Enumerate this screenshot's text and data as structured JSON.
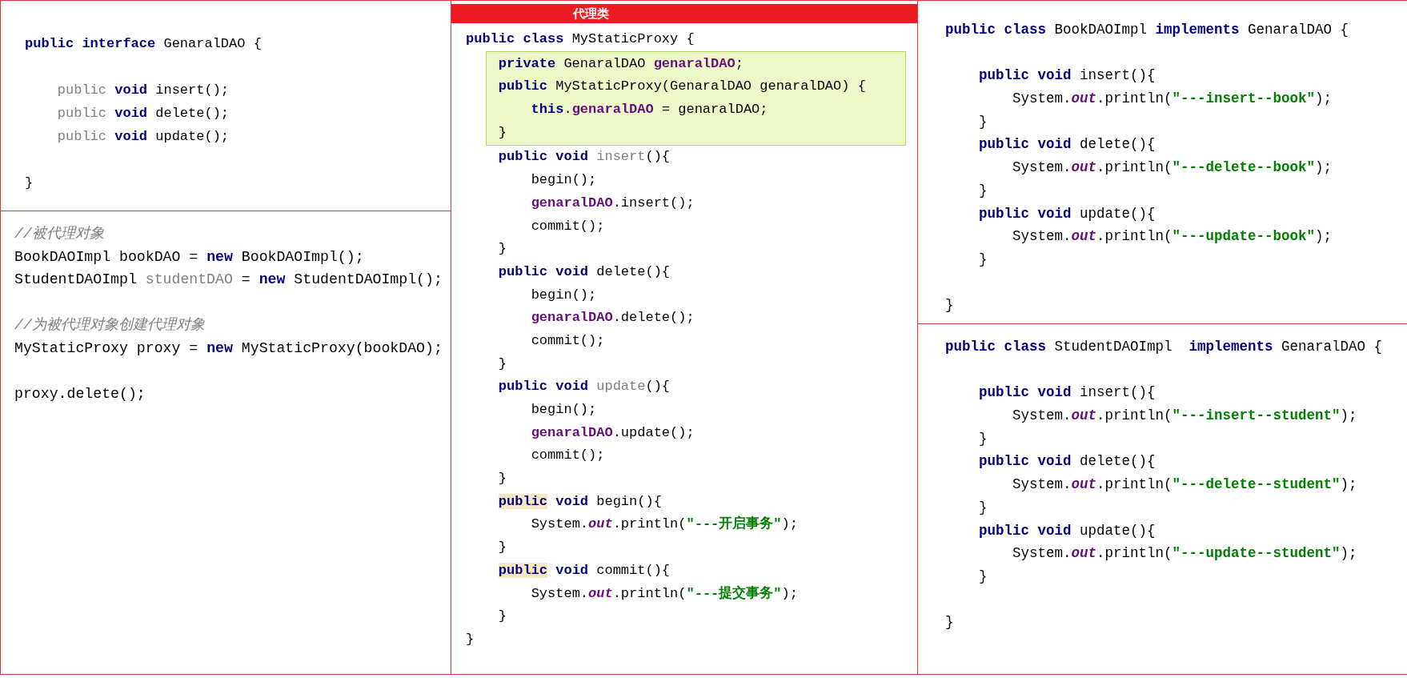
{
  "columns": [
    {
      "panels": [
        {
          "blocks": [
            {
              "boxed": false,
              "lines": [
                {
                  "kind": "code",
                  "segments": [
                    {
                      "kind": "keyword",
                      "text": "public interface "
                    },
                    {
                      "kind": "plain",
                      "text": "GenaralDAO {"
                    }
                  ]
                },
                {
                  "kind": "blank"
                },
                {
                  "kind": "code",
                  "segments": [
                    {
                      "kind": "unused",
                      "text": "    public "
                    },
                    {
                      "kind": "keyword",
                      "text": "void "
                    },
                    {
                      "kind": "plain",
                      "text": "insert();"
                    }
                  ]
                },
                {
                  "kind": "code",
                  "segments": [
                    {
                      "kind": "unused",
                      "text": "    public "
                    },
                    {
                      "kind": "keyword",
                      "text": "void "
                    },
                    {
                      "kind": "plain",
                      "text": "delete();"
                    }
                  ]
                },
                {
                  "kind": "code",
                  "segments": [
                    {
                      "kind": "unused",
                      "text": "    public "
                    },
                    {
                      "kind": "keyword",
                      "text": "void "
                    },
                    {
                      "kind": "plain",
                      "text": "update();"
                    }
                  ]
                },
                {
                  "kind": "blank"
                },
                {
                  "kind": "code",
                  "segments": [
                    {
                      "kind": "plain",
                      "text": "}"
                    }
                  ]
                }
              ]
            }
          ]
        },
        {
          "blocks": [
            {
              "boxed": false,
              "lines": [
                {
                  "kind": "code",
                  "segments": [
                    {
                      "kind": "comment",
                      "text": "//被代理对象"
                    }
                  ]
                },
                {
                  "kind": "code",
                  "segments": [
                    {
                      "kind": "plain",
                      "text": "BookDAOImpl bookDAO = "
                    },
                    {
                      "kind": "keyword",
                      "text": "new "
                    },
                    {
                      "kind": "plain",
                      "text": "BookDAOImpl();"
                    }
                  ]
                },
                {
                  "kind": "code",
                  "segments": [
                    {
                      "kind": "plain",
                      "text": "StudentDAOImpl "
                    },
                    {
                      "kind": "unused",
                      "text": "studentDAO"
                    },
                    {
                      "kind": "plain",
                      "text": " = "
                    },
                    {
                      "kind": "keyword",
                      "text": "new "
                    },
                    {
                      "kind": "plain",
                      "text": "StudentDAOImpl();"
                    }
                  ]
                },
                {
                  "kind": "blank"
                },
                {
                  "kind": "code",
                  "segments": [
                    {
                      "kind": "comment",
                      "text": "//为被代理对象创建代理对象"
                    }
                  ]
                },
                {
                  "kind": "code",
                  "segments": [
                    {
                      "kind": "plain",
                      "text": "MyStaticProxy proxy = "
                    },
                    {
                      "kind": "keyword",
                      "text": "new "
                    },
                    {
                      "kind": "plain",
                      "text": "MyStaticProxy(bookDAO);"
                    }
                  ]
                },
                {
                  "kind": "blank"
                },
                {
                  "kind": "code",
                  "segments": [
                    {
                      "kind": "plain",
                      "text": "proxy.delete();"
                    }
                  ]
                }
              ]
            }
          ]
        }
      ]
    },
    {
      "panels": [
        {
          "title": "代理类",
          "blocks": [
            {
              "boxed": false,
              "lines": [
                {
                  "kind": "code",
                  "segments": [
                    {
                      "kind": "keyword",
                      "text": "public class "
                    },
                    {
                      "kind": "plain",
                      "text": "MyStaticProxy {"
                    }
                  ]
                }
              ]
            },
            {
              "boxed": true,
              "lines": [
                {
                  "kind": "code",
                  "segments": [
                    {
                      "kind": "keyword",
                      "text": "private "
                    },
                    {
                      "kind": "plain",
                      "text": "GenaralDAO "
                    },
                    {
                      "kind": "field",
                      "text": "genaralDAO"
                    },
                    {
                      "kind": "plain",
                      "text": ";"
                    }
                  ]
                },
                {
                  "kind": "code",
                  "segments": [
                    {
                      "kind": "keyword",
                      "text": "public "
                    },
                    {
                      "kind": "plain",
                      "text": "MyStaticProxy(GenaralDAO genaralDAO) {"
                    }
                  ]
                },
                {
                  "kind": "code",
                  "segments": [
                    {
                      "kind": "keyword",
                      "text": "    this"
                    },
                    {
                      "kind": "plain",
                      "text": "."
                    },
                    {
                      "kind": "field",
                      "text": "genaralDAO"
                    },
                    {
                      "kind": "plain",
                      "text": " = genaralDAO;"
                    }
                  ]
                },
                {
                  "kind": "code",
                  "segments": [
                    {
                      "kind": "plain",
                      "text": "}"
                    }
                  ]
                }
              ]
            },
            {
              "boxed": false,
              "lines": [
                {
                  "kind": "code",
                  "segments": [
                    {
                      "kind": "keyword",
                      "text": "    public void "
                    },
                    {
                      "kind": "unused",
                      "text": "insert"
                    },
                    {
                      "kind": "plain",
                      "text": "(){"
                    }
                  ]
                },
                {
                  "kind": "code",
                  "segments": [
                    {
                      "kind": "plain",
                      "text": "        begin();"
                    }
                  ]
                },
                {
                  "kind": "code",
                  "segments": [
                    {
                      "kind": "field",
                      "text": "        genaralDAO"
                    },
                    {
                      "kind": "plain",
                      "text": ".insert();"
                    }
                  ]
                },
                {
                  "kind": "code",
                  "segments": [
                    {
                      "kind": "plain",
                      "text": "        commit();"
                    }
                  ]
                },
                {
                  "kind": "code",
                  "segments": [
                    {
                      "kind": "plain",
                      "text": "    }"
                    }
                  ]
                },
                {
                  "kind": "code",
                  "segments": [
                    {
                      "kind": "keyword",
                      "text": "    public void "
                    },
                    {
                      "kind": "plain",
                      "text": "delete(){"
                    }
                  ]
                },
                {
                  "kind": "code",
                  "segments": [
                    {
                      "kind": "plain",
                      "text": "        begin();"
                    }
                  ]
                },
                {
                  "kind": "code",
                  "segments": [
                    {
                      "kind": "field",
                      "text": "        genaralDAO"
                    },
                    {
                      "kind": "plain",
                      "text": ".delete();"
                    }
                  ]
                },
                {
                  "kind": "code",
                  "segments": [
                    {
                      "kind": "plain",
                      "text": "        commit();"
                    }
                  ]
                },
                {
                  "kind": "code",
                  "segments": [
                    {
                      "kind": "plain",
                      "text": "    }"
                    }
                  ]
                },
                {
                  "kind": "code",
                  "segments": [
                    {
                      "kind": "keyword",
                      "text": "    public void "
                    },
                    {
                      "kind": "unused",
                      "text": "update"
                    },
                    {
                      "kind": "plain",
                      "text": "(){"
                    }
                  ]
                },
                {
                  "kind": "code",
                  "segments": [
                    {
                      "kind": "plain",
                      "text": "        begin();"
                    }
                  ]
                },
                {
                  "kind": "code",
                  "segments": [
                    {
                      "kind": "field",
                      "text": "        genaralDAO"
                    },
                    {
                      "kind": "plain",
                      "text": ".update();"
                    }
                  ]
                },
                {
                  "kind": "code",
                  "segments": [
                    {
                      "kind": "plain",
                      "text": "        commit();"
                    }
                  ]
                },
                {
                  "kind": "code",
                  "segments": [
                    {
                      "kind": "plain",
                      "text": "    }"
                    }
                  ]
                },
                {
                  "kind": "code",
                  "segments": [
                    {
                      "kind": "marked",
                      "text": "    public"
                    },
                    {
                      "kind": "keyword",
                      "text": " void "
                    },
                    {
                      "kind": "plain",
                      "text": "begin(){"
                    }
                  ]
                },
                {
                  "kind": "code",
                  "segments": [
                    {
                      "kind": "plain",
                      "text": "        System."
                    },
                    {
                      "kind": "static",
                      "text": "out"
                    },
                    {
                      "kind": "plain",
                      "text": ".println("
                    },
                    {
                      "kind": "string",
                      "text": "\"---开启事务\""
                    },
                    {
                      "kind": "plain",
                      "text": ");"
                    }
                  ]
                },
                {
                  "kind": "code",
                  "segments": [
                    {
                      "kind": "plain",
                      "text": "    }"
                    }
                  ]
                },
                {
                  "kind": "code",
                  "segments": [
                    {
                      "kind": "marked",
                      "text": "    public"
                    },
                    {
                      "kind": "keyword",
                      "text": " void "
                    },
                    {
                      "kind": "plain",
                      "text": "commit(){"
                    }
                  ]
                },
                {
                  "kind": "code",
                  "segments": [
                    {
                      "kind": "plain",
                      "text": "        System."
                    },
                    {
                      "kind": "static",
                      "text": "out"
                    },
                    {
                      "kind": "plain",
                      "text": ".println("
                    },
                    {
                      "kind": "string",
                      "text": "\"---提交事务\""
                    },
                    {
                      "kind": "plain",
                      "text": ");"
                    }
                  ]
                },
                {
                  "kind": "code",
                  "segments": [
                    {
                      "kind": "plain",
                      "text": "    }"
                    }
                  ]
                },
                {
                  "kind": "code",
                  "segments": [
                    {
                      "kind": "plain",
                      "text": "}"
                    }
                  ]
                }
              ]
            }
          ]
        }
      ]
    },
    {
      "panels": [
        {
          "blocks": [
            {
              "boxed": false,
              "lines": [
                {
                  "kind": "code",
                  "segments": [
                    {
                      "kind": "keyword",
                      "text": "public class "
                    },
                    {
                      "kind": "plain",
                      "text": "BookDAOImpl "
                    },
                    {
                      "kind": "keyword",
                      "text": "implements "
                    },
                    {
                      "kind": "plain",
                      "text": "GenaralDAO {"
                    }
                  ]
                },
                {
                  "kind": "blank"
                },
                {
                  "kind": "code",
                  "segments": [
                    {
                      "kind": "keyword",
                      "text": "    public void "
                    },
                    {
                      "kind": "plain",
                      "text": "insert(){"
                    }
                  ]
                },
                {
                  "kind": "code",
                  "segments": [
                    {
                      "kind": "plain",
                      "text": "        System."
                    },
                    {
                      "kind": "static",
                      "text": "out"
                    },
                    {
                      "kind": "plain",
                      "text": ".println("
                    },
                    {
                      "kind": "string",
                      "text": "\"---insert--book\""
                    },
                    {
                      "kind": "plain",
                      "text": ");"
                    }
                  ]
                },
                {
                  "kind": "code",
                  "segments": [
                    {
                      "kind": "plain",
                      "text": "    }"
                    }
                  ]
                },
                {
                  "kind": "code",
                  "segments": [
                    {
                      "kind": "keyword",
                      "text": "    public void "
                    },
                    {
                      "kind": "plain",
                      "text": "delete(){"
                    }
                  ]
                },
                {
                  "kind": "code",
                  "segments": [
                    {
                      "kind": "plain",
                      "text": "        System."
                    },
                    {
                      "kind": "static",
                      "text": "out"
                    },
                    {
                      "kind": "plain",
                      "text": ".println("
                    },
                    {
                      "kind": "string",
                      "text": "\"---delete--book\""
                    },
                    {
                      "kind": "plain",
                      "text": ");"
                    }
                  ]
                },
                {
                  "kind": "code",
                  "segments": [
                    {
                      "kind": "plain",
                      "text": "    }"
                    }
                  ]
                },
                {
                  "kind": "code",
                  "segments": [
                    {
                      "kind": "keyword",
                      "text": "    public void "
                    },
                    {
                      "kind": "plain",
                      "text": "update(){"
                    }
                  ]
                },
                {
                  "kind": "code",
                  "segments": [
                    {
                      "kind": "plain",
                      "text": "        System."
                    },
                    {
                      "kind": "static",
                      "text": "out"
                    },
                    {
                      "kind": "plain",
                      "text": ".println("
                    },
                    {
                      "kind": "string",
                      "text": "\"---update--book\""
                    },
                    {
                      "kind": "plain",
                      "text": ");"
                    }
                  ]
                },
                {
                  "kind": "code",
                  "segments": [
                    {
                      "kind": "plain",
                      "text": "    }"
                    }
                  ]
                },
                {
                  "kind": "blank"
                },
                {
                  "kind": "code",
                  "segments": [
                    {
                      "kind": "plain",
                      "text": "}"
                    }
                  ]
                }
              ]
            }
          ]
        },
        {
          "blocks": [
            {
              "boxed": false,
              "lines": [
                {
                  "kind": "code",
                  "segments": [
                    {
                      "kind": "keyword",
                      "text": "public class "
                    },
                    {
                      "kind": "plain",
                      "text": "StudentDAOImpl  "
                    },
                    {
                      "kind": "keyword",
                      "text": "implements "
                    },
                    {
                      "kind": "plain",
                      "text": "GenaralDAO {"
                    }
                  ]
                },
                {
                  "kind": "blank"
                },
                {
                  "kind": "code",
                  "segments": [
                    {
                      "kind": "keyword",
                      "text": "    public void "
                    },
                    {
                      "kind": "plain",
                      "text": "insert(){"
                    }
                  ]
                },
                {
                  "kind": "code",
                  "segments": [
                    {
                      "kind": "plain",
                      "text": "        System."
                    },
                    {
                      "kind": "static",
                      "text": "out"
                    },
                    {
                      "kind": "plain",
                      "text": ".println("
                    },
                    {
                      "kind": "string",
                      "text": "\"---insert--student\""
                    },
                    {
                      "kind": "plain",
                      "text": ");"
                    }
                  ]
                },
                {
                  "kind": "code",
                  "segments": [
                    {
                      "kind": "plain",
                      "text": "    }"
                    }
                  ]
                },
                {
                  "kind": "code",
                  "segments": [
                    {
                      "kind": "keyword",
                      "text": "    public void "
                    },
                    {
                      "kind": "plain",
                      "text": "delete(){"
                    }
                  ]
                },
                {
                  "kind": "code",
                  "segments": [
                    {
                      "kind": "plain",
                      "text": "        System."
                    },
                    {
                      "kind": "static",
                      "text": "out"
                    },
                    {
                      "kind": "plain",
                      "text": ".println("
                    },
                    {
                      "kind": "string",
                      "text": "\"---delete--student\""
                    },
                    {
                      "kind": "plain",
                      "text": ");"
                    }
                  ]
                },
                {
                  "kind": "code",
                  "segments": [
                    {
                      "kind": "plain",
                      "text": "    }"
                    }
                  ]
                },
                {
                  "kind": "code",
                  "segments": [
                    {
                      "kind": "keyword",
                      "text": "    public void "
                    },
                    {
                      "kind": "plain",
                      "text": "update(){"
                    }
                  ]
                },
                {
                  "kind": "code",
                  "segments": [
                    {
                      "kind": "plain",
                      "text": "        System."
                    },
                    {
                      "kind": "static",
                      "text": "out"
                    },
                    {
                      "kind": "plain",
                      "text": ".println("
                    },
                    {
                      "kind": "string",
                      "text": "\"---update--student\""
                    },
                    {
                      "kind": "plain",
                      "text": ");"
                    }
                  ]
                },
                {
                  "kind": "code",
                  "segments": [
                    {
                      "kind": "plain",
                      "text": "    }"
                    }
                  ]
                },
                {
                  "kind": "blank"
                },
                {
                  "kind": "code",
                  "segments": [
                    {
                      "kind": "plain",
                      "text": "}"
                    }
                  ]
                }
              ]
            }
          ]
        }
      ]
    }
  ]
}
